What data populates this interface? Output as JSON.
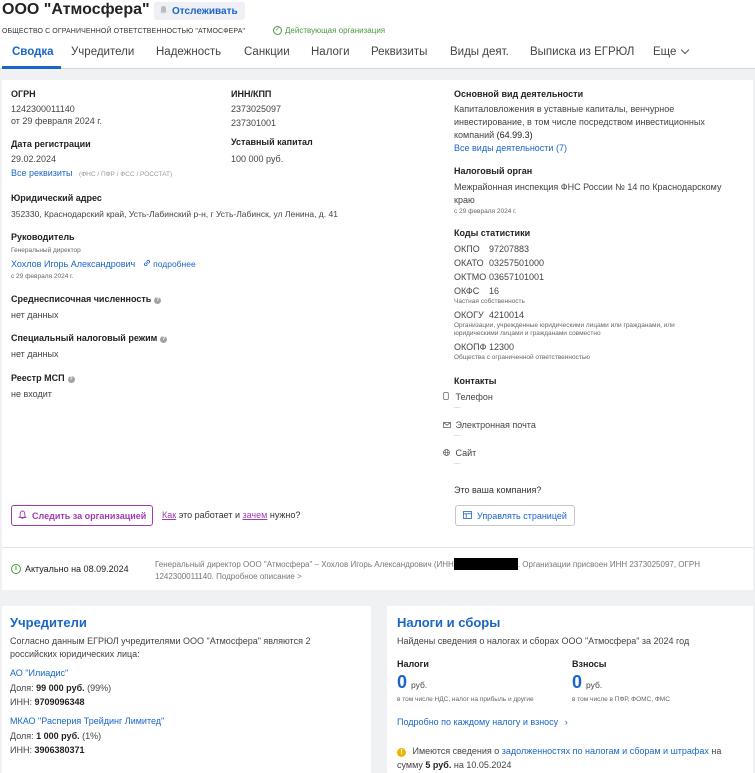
{
  "header": {
    "title": "ООО \"Атмосфера\"",
    "follow_label": "Отслеживать",
    "full_name": "ОБЩЕСТВО С ОГРАНИЧЕННОЙ ОТВЕТСТВЕННОСТЬЮ \"АТМОСФЕРА\"",
    "status": "Действующая организация"
  },
  "tabs": [
    {
      "label": "Сводка"
    },
    {
      "label": "Учредители"
    },
    {
      "label": "Надежность"
    },
    {
      "label": "Санкции"
    },
    {
      "label": "Налоги"
    },
    {
      "label": "Реквизиты"
    },
    {
      "label": "Виды деят."
    },
    {
      "label": "Выписка из ЕГРЮЛ"
    },
    {
      "label": "Еще"
    }
  ],
  "summary": {
    "ogrn_label": "ОГРН",
    "ogrn": "1242300011140",
    "ogrn_date": "от 29 февраля 2024 г.",
    "inn_kpp_label": "ИНН/КПП",
    "inn": "2373025097",
    "kpp": "237301001",
    "reg_date_label": "Дата регистрации",
    "reg_date": "29.02.2024",
    "capital_label": "Уставный капитал",
    "capital": "100 000 руб.",
    "all_requisites": "Все реквизиты",
    "requisites_note": "(ФНС / ПФР / ФСС / РОССТАТ)",
    "address_label": "Юридический адрес",
    "address": "352330, Краснодарский край, Усть-Лабинский р-н, г Усть-Лабинск, ул Ленина, д. 41",
    "head_label": "Руководитель",
    "head_role": "Генеральный директор",
    "head_name": "Хохлов Игорь Александрович",
    "head_more": "подробнее",
    "head_date": "с 29 февраля 2024 г.",
    "headcount_label": "Среднесписочная численность",
    "headcount": "нет данных",
    "tax_regime_label": "Специальный налоговый режим",
    "tax_regime": "нет данных",
    "msp_label": "Реестр МСП",
    "msp": "не входит",
    "activity_label": "Основной вид деятельности",
    "activity_line1": "Капиталовложения в уставные капиталы, венчурное",
    "activity_line2": "инвестирование, в том числе посредством инвестиционных",
    "activity_line3": "компаний",
    "activity_code": "(64.99.3)",
    "activity_all": "Все виды деятельности (7)",
    "tax_org_label": "Налоговый орган",
    "tax_org_line1": "Межрайонная инспекция ФНС России № 14 по Краснодарскому",
    "tax_org_line2": "краю",
    "tax_org_date": "с 29 февраля 2024 г.",
    "stat_codes_label": "Коды статистики",
    "okpo_k": "ОКПО",
    "okpo": "97207883",
    "okato_k": "ОКАТО",
    "okato": "03257501000",
    "oktmo_k": "ОКТМО",
    "oktmo": "03657101001",
    "okfs_k": "ОКФС",
    "okfs": "16",
    "okfs_desc": "Частная собственность",
    "okogu_k": "ОКОГУ",
    "okogu": "4210014",
    "okogu_desc1": "Организации, учрежденные юридическими лицами или гражданами, или",
    "okogu_desc2": "юридическими лицами и гражданами совместно",
    "okopf_k": "ОКОПФ",
    "okopf": "12300",
    "okopf_desc": "Общества с ограниченной ответственностью",
    "contacts_label": "Контакты",
    "phone_label": "Телефон",
    "email_label": "Электронная почта",
    "site_label": "Сайт",
    "dash": "—",
    "your_company": "Это ваша компания?",
    "manage_btn": "Управлять страницей",
    "watch_btn": "Следить за организацией",
    "howto_a": "Как",
    "howto_b": "это работает и",
    "howto_c": "зачем",
    "howto_d": "нужно?",
    "actual": "Актуально на 08.09.2024",
    "desc_a": "Генеральный директор ООО \"Атмосфера\" – Хохлов Игорь Александрович (ИНН",
    "desc_b": ". Организации присвоен ИНН 2373025097, ОГРН",
    "desc_c": "1242300011140.",
    "desc_more": "Подробное описание >"
  },
  "founders": {
    "title": "Учредители",
    "intro1": "Согласно данным ЕГРЮЛ учредителями ООО \"Атмосфера\" являются 2",
    "intro2": "российских юридических лица:",
    "f1_name": "АО \"Илиадис\"",
    "share_label": "Доля:",
    "f1_share": "99 000 руб.",
    "f1_pct": "(99%)",
    "inn_label": "ИНН:",
    "f1_inn": "9709096348",
    "f2_name": "МКАО \"Расперия Трейдинг Лимитед\"",
    "f2_share": "1 000 руб.",
    "f2_pct": "(1%)",
    "f2_inn": "3906380371"
  },
  "taxes": {
    "title": "Налоги и сборы",
    "intro": "Найдены сведения о налогах и сборах ООО \"Атмосфера\" за 2024 год",
    "taxes_label": "Налоги",
    "taxes_value": "0",
    "rub": "руб.",
    "taxes_note": "в том числе НДС, налог на прибыль и другие",
    "fees_label": "Взносы",
    "fees_value": "0",
    "fees_note": "в том числе в ПФР, ФОМС, ФМС",
    "detail_link": "Подробно по каждому налогу и взносу",
    "debt_a": "Имеются сведения о",
    "debt_link": "задолженностях по налогам и сборам и штрафах",
    "debt_b": "на",
    "debt_c": "сумму",
    "debt_sum": "5 руб.",
    "debt_d": "на 10.05.2024"
  },
  "colors": {
    "accent": "#1a66c8",
    "success": "#4a9a3f",
    "brand_purple": "#a13ab3",
    "warning": "#f0b400"
  }
}
